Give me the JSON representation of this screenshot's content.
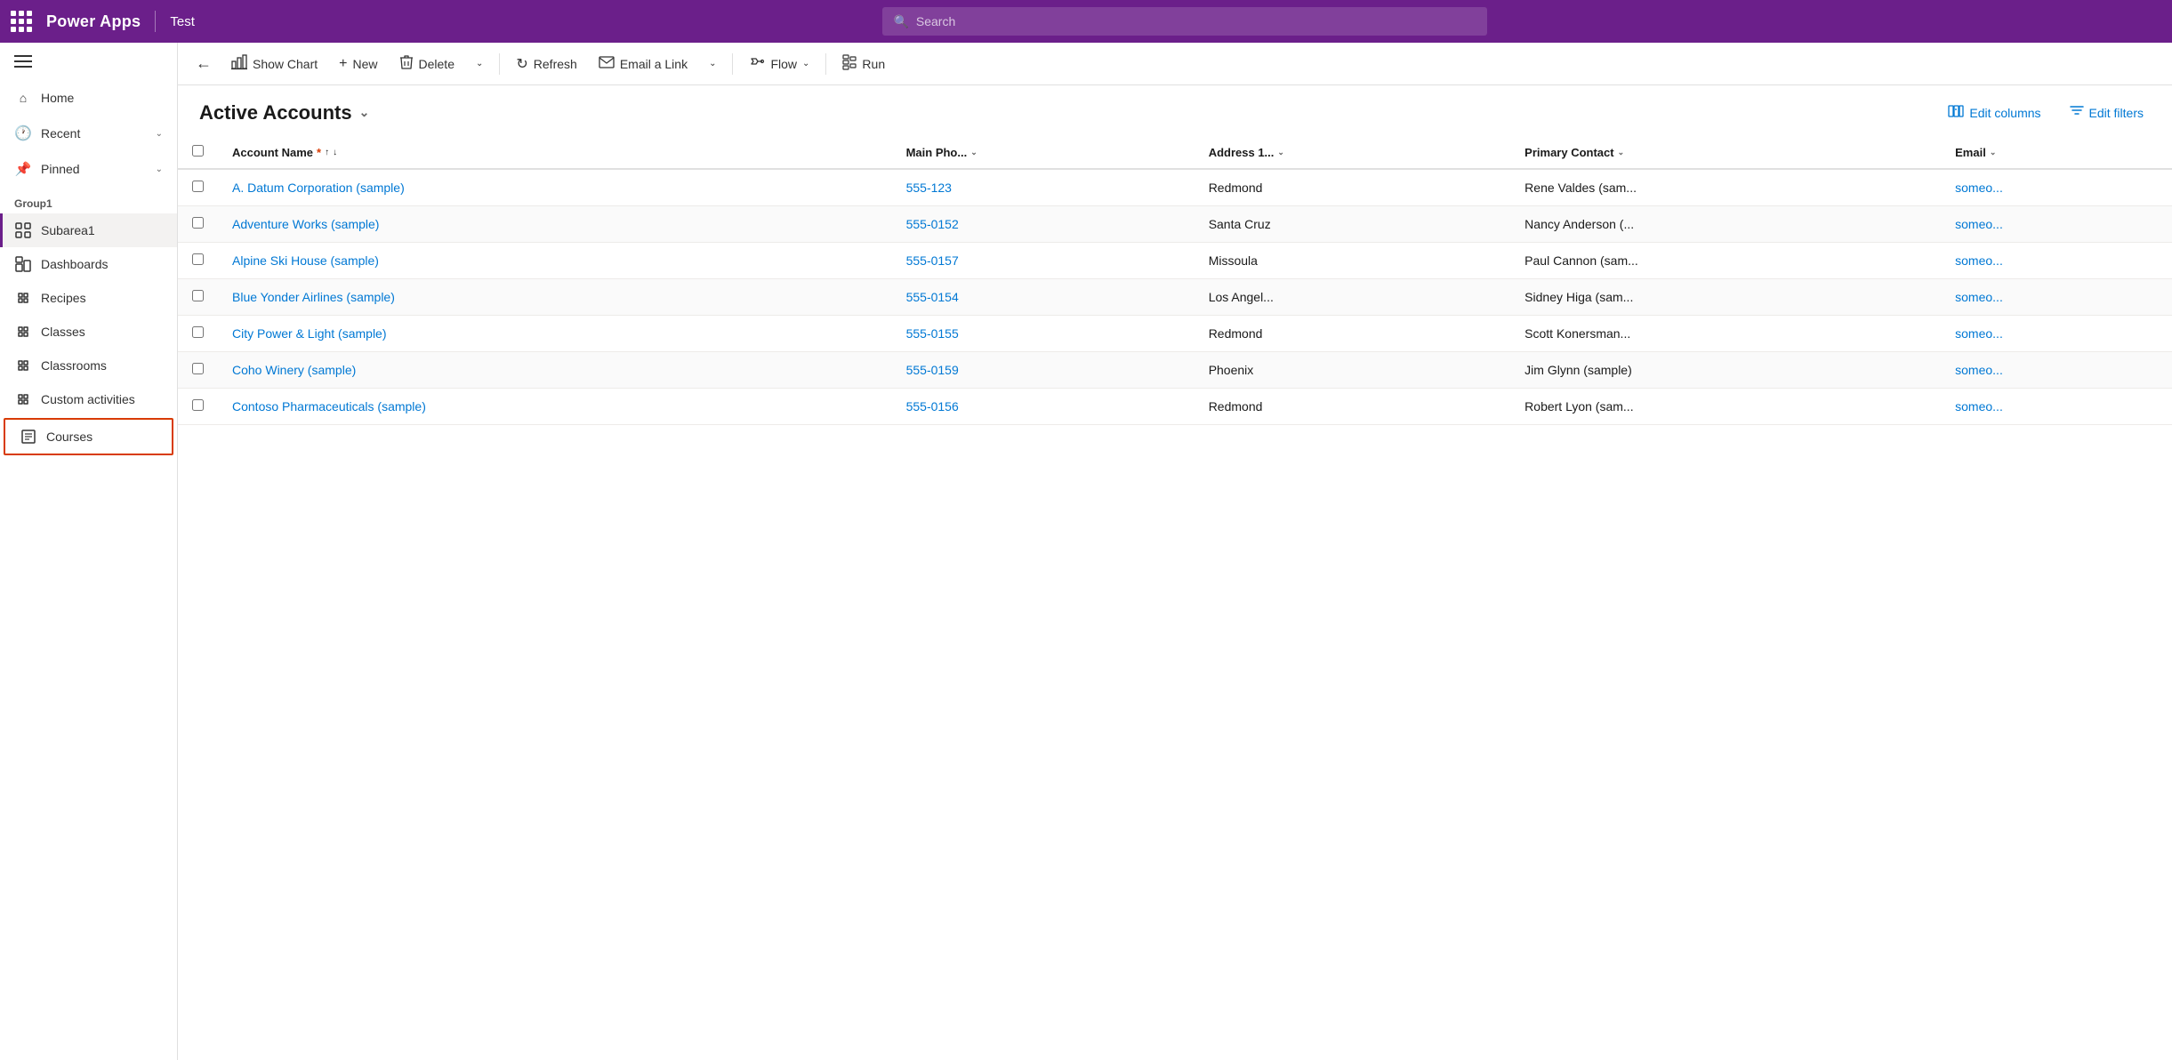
{
  "topbar": {
    "dots_label": "App launcher",
    "title": "Power Apps",
    "divider": "|",
    "app_name": "Test",
    "search_placeholder": "Search"
  },
  "sidebar": {
    "hamburger_label": "Navigation menu",
    "nav_items": [
      {
        "id": "home",
        "label": "Home",
        "icon": "home",
        "has_chevron": false
      },
      {
        "id": "recent",
        "label": "Recent",
        "icon": "recent",
        "has_chevron": true
      },
      {
        "id": "pinned",
        "label": "Pinned",
        "icon": "pin",
        "has_chevron": true
      }
    ],
    "group_label": "Group1",
    "sub_items": [
      {
        "id": "subarea1",
        "label": "Subarea1",
        "icon": "grid",
        "active": true,
        "highlighted": false
      },
      {
        "id": "dashboards",
        "label": "Dashboards",
        "icon": "dashboard",
        "active": false,
        "highlighted": false
      },
      {
        "id": "recipes",
        "label": "Recipes",
        "icon": "puzzle",
        "active": false,
        "highlighted": false
      },
      {
        "id": "classes",
        "label": "Classes",
        "icon": "puzzle",
        "active": false,
        "highlighted": false
      },
      {
        "id": "classrooms",
        "label": "Classrooms",
        "icon": "puzzle",
        "active": false,
        "highlighted": false
      },
      {
        "id": "custom-activities",
        "label": "Custom activities",
        "icon": "puzzle",
        "active": false,
        "highlighted": false
      },
      {
        "id": "courses",
        "label": "Courses",
        "icon": "doc",
        "active": false,
        "highlighted": true
      }
    ]
  },
  "toolbar": {
    "back_label": "←",
    "show_chart_label": "Show Chart",
    "new_label": "New",
    "delete_label": "Delete",
    "refresh_label": "Refresh",
    "email_link_label": "Email a Link",
    "flow_label": "Flow",
    "run_label": "Run"
  },
  "view": {
    "title": "Active Accounts",
    "title_chevron": "⌄",
    "edit_columns_label": "Edit columns",
    "edit_filters_label": "Edit filters"
  },
  "table": {
    "columns": [
      {
        "id": "account_name",
        "label": "Account Name",
        "required": true,
        "sortable": true,
        "has_chevron": true
      },
      {
        "id": "main_phone",
        "label": "Main Pho...",
        "sortable": false,
        "has_chevron": true
      },
      {
        "id": "address",
        "label": "Address 1...",
        "sortable": false,
        "has_chevron": true
      },
      {
        "id": "primary_contact",
        "label": "Primary Contact",
        "sortable": false,
        "has_chevron": true
      },
      {
        "id": "email",
        "label": "Email",
        "sortable": false,
        "has_chevron": true
      }
    ],
    "rows": [
      {
        "id": 1,
        "account_name": "A. Datum Corporation (sample)",
        "main_phone": "555-123",
        "address": "Redmond",
        "primary_contact": "Rene Valdes (sam...",
        "email": "someo..."
      },
      {
        "id": 2,
        "account_name": "Adventure Works (sample)",
        "main_phone": "555-0152",
        "address": "Santa Cruz",
        "primary_contact": "Nancy Anderson (...",
        "email": "someo..."
      },
      {
        "id": 3,
        "account_name": "Alpine Ski House (sample)",
        "main_phone": "555-0157",
        "address": "Missoula",
        "primary_contact": "Paul Cannon (sam...",
        "email": "someo..."
      },
      {
        "id": 4,
        "account_name": "Blue Yonder Airlines (sample)",
        "main_phone": "555-0154",
        "address": "Los Angel...",
        "primary_contact": "Sidney Higa (sam...",
        "email": "someo..."
      },
      {
        "id": 5,
        "account_name": "City Power & Light (sample)",
        "main_phone": "555-0155",
        "address": "Redmond",
        "primary_contact": "Scott Konersman...",
        "email": "someo..."
      },
      {
        "id": 6,
        "account_name": "Coho Winery (sample)",
        "main_phone": "555-0159",
        "address": "Phoenix",
        "primary_contact": "Jim Glynn (sample)",
        "email": "someo..."
      },
      {
        "id": 7,
        "account_name": "Contoso Pharmaceuticals (sample)",
        "main_phone": "555-0156",
        "address": "Redmond",
        "primary_contact": "Robert Lyon (sam...",
        "email": "someo..."
      }
    ]
  },
  "colors": {
    "purple": "#6b1f8a",
    "link_blue": "#0078d4",
    "active_border": "#6b1f8a",
    "highlight_border": "#d83b01"
  },
  "icons": {
    "home": "⌂",
    "recent": "🕐",
    "pin": "📌",
    "grid": "⊞",
    "dashboard": "▦",
    "puzzle": "✦",
    "doc": "📄",
    "search": "🔍",
    "show_chart": "📊",
    "new_plus": "+",
    "delete_trash": "🗑",
    "refresh": "↻",
    "email": "✉",
    "flow": "⇒",
    "run": "▶",
    "edit_columns": "⊟",
    "edit_filters": "▼"
  }
}
